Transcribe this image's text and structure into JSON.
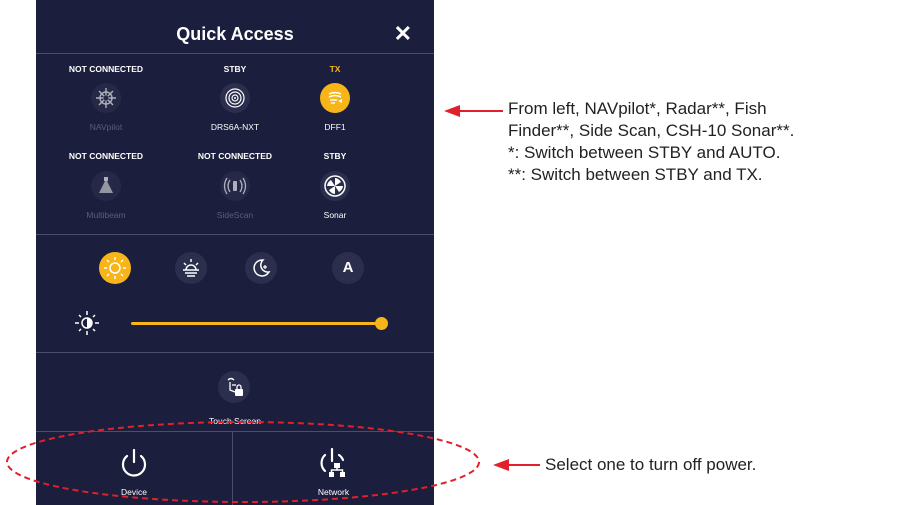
{
  "header": {
    "title": "Quick Access",
    "close_glyph": "✕"
  },
  "devices_row1": [
    {
      "status": "NOT CONNECTED",
      "label": "NAVpilot",
      "icon": "navpilot-icon",
      "connected": false
    },
    {
      "status": "STBY",
      "label": "DRS6A-NXT",
      "icon": "radar-icon",
      "connected": true
    },
    {
      "status": "TX",
      "label": "DFF1",
      "icon": "fish-finder-icon",
      "connected": true,
      "transmitting": true
    }
  ],
  "devices_row2": [
    {
      "status": "NOT CONNECTED",
      "label": "Multibeam",
      "icon": "multibeam-icon",
      "connected": false
    },
    {
      "status": "NOT CONNECTED",
      "label": "SideScan",
      "icon": "sidescan-icon",
      "connected": false
    },
    {
      "status": "STBY",
      "label": "Sonar",
      "icon": "sonar-icon",
      "connected": true
    }
  ],
  "display_modes": [
    {
      "name": "day",
      "icon": "sun-icon",
      "active": true
    },
    {
      "name": "dusk",
      "icon": "sunset-icon",
      "active": false
    },
    {
      "name": "night",
      "icon": "moon-icon",
      "active": false
    },
    {
      "name": "auto",
      "icon": "auto-icon",
      "label": "A",
      "active": false
    }
  ],
  "brightness": {
    "icon": "brightness-icon",
    "level": 1.0
  },
  "touch_lock": {
    "icon": "touch-lock-icon",
    "label": "Touch Screen"
  },
  "power": [
    {
      "label": "Device",
      "icon": "power-icon"
    },
    {
      "label": "Network",
      "icon": "network-power-icon"
    }
  ],
  "annotations": {
    "devices_lines": [
      "From left, NAVpilot*, Radar**, Fish",
      "Finder**, Side Scan, CSH-10 Sonar**.",
      "*: Switch between STBY and AUTO.",
      "**: Switch between STBY and TX."
    ],
    "power_note": "Select one to turn off power."
  },
  "colors": {
    "panel_bg": "#1b1e3c",
    "accent": "#f7b51a",
    "callout_red": "#e0202a"
  }
}
